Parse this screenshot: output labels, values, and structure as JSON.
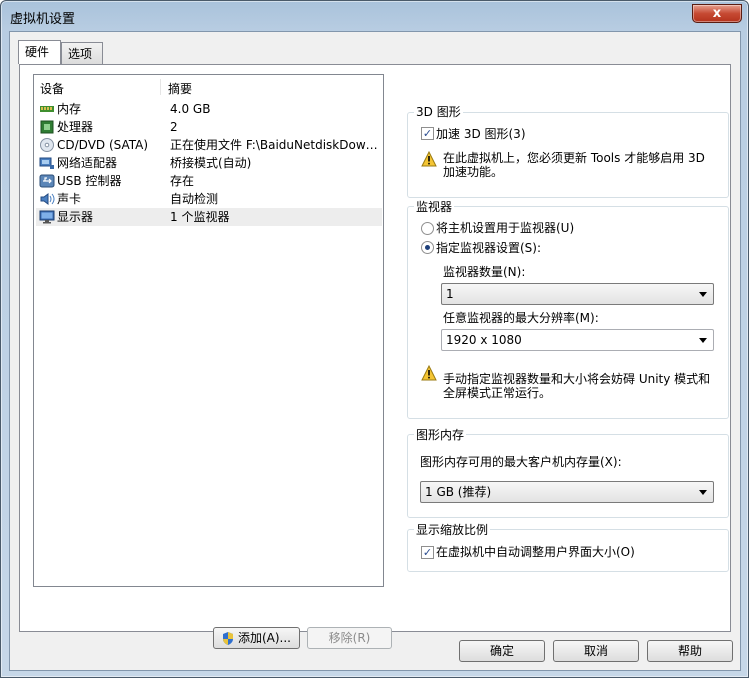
{
  "window": {
    "title": "虚拟机设置",
    "close_label": "x"
  },
  "tabs": [
    {
      "label": "硬件"
    },
    {
      "label": "选项"
    }
  ],
  "devices": {
    "col_device": "设备",
    "col_summary": "摘要",
    "items": [
      {
        "name": "内存",
        "summary": "4.0 GB",
        "icon": "memory-icon"
      },
      {
        "name": "处理器",
        "summary": "2",
        "icon": "processor-icon"
      },
      {
        "name": "CD/DVD (SATA)",
        "summary": "正在使用文件 F:\\BaiduNetdiskDownl...",
        "icon": "cd-dvd-icon"
      },
      {
        "name": "网络适配器",
        "summary": "桥接模式(自动)",
        "icon": "network-adapter-icon"
      },
      {
        "name": "USB 控制器",
        "summary": "存在",
        "icon": "usb-icon"
      },
      {
        "name": "声卡",
        "summary": "自动检测",
        "icon": "sound-card-icon"
      },
      {
        "name": "显示器",
        "summary": "1 个监视器",
        "icon": "display-icon",
        "selected": true
      }
    ],
    "add_label": "添加(A)...",
    "remove_label": "移除(R)"
  },
  "graphics3d": {
    "title": "3D 图形",
    "accelerate_label": "加速 3D 图形(3)",
    "accelerate_checked": true,
    "warning_text_1": "在此虚拟机上，您必须更新 Tools 才能够启用 3D",
    "warning_text_2": "加速功能。"
  },
  "monitor": {
    "title": "监视器",
    "host_option_label": "将主机设置用于监视器(U)",
    "custom_option_label": "指定监视器设置(S):",
    "selected_option": "custom",
    "count_label": "监视器数量(N):",
    "count_value": "1",
    "maxres_label": "任意监视器的最大分辨率(M):",
    "maxres_value": "1920 x 1080",
    "warning_text_1": "手动指定监视器数量和大小将会妨碍 Unity 模式和",
    "warning_text_2": "全屏模式正常运行。"
  },
  "graphics_memory": {
    "title": "图形内存",
    "label": "图形内存可用的最大客户机内存量(X):",
    "value": "1 GB (推荐)"
  },
  "scaling": {
    "title": "显示缩放比例",
    "autosize_label": "在虚拟机中自动调整用户界面大小(O)",
    "autosize_checked": true
  },
  "footer": {
    "ok_label": "确定",
    "cancel_label": "取消",
    "help_label": "帮助"
  },
  "colors": {
    "title_gradient": "#b8cde2",
    "close_button": "#c64a33",
    "selection": "#ededed"
  }
}
